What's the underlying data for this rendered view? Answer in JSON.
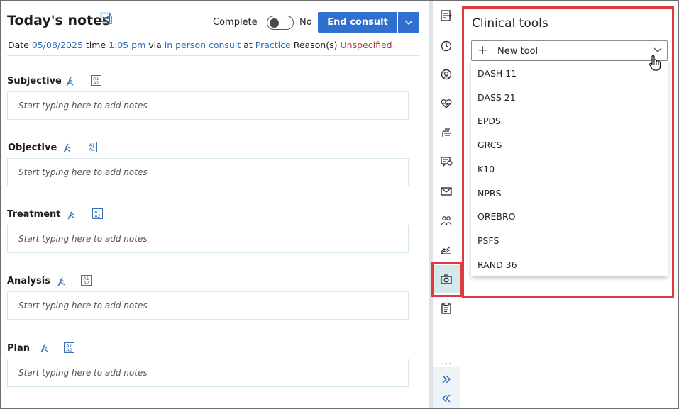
{
  "header": {
    "title": "Today's notes",
    "complete_label": "Complete",
    "toggle_value": "No",
    "end_consult_label": "End consult"
  },
  "meta": {
    "date_label": "Date",
    "date": "05/08/2025",
    "time_label": "time",
    "time": "1:05 pm",
    "via_label": "via",
    "via": "in person consult",
    "at_label": "at",
    "location": "Practice",
    "reason_label": "Reason(s)",
    "reason": "Unspecified"
  },
  "sections": [
    {
      "label": "Subjective",
      "placeholder": "Start typing here to add notes"
    },
    {
      "label": "Objective",
      "placeholder": "Start typing here to add notes"
    },
    {
      "label": "Treatment",
      "placeholder": "Start typing here to add notes"
    },
    {
      "label": "Analysis",
      "placeholder": "Start typing here to add notes"
    },
    {
      "label": "Plan",
      "placeholder": "Start typing here to add notes"
    }
  ],
  "aa_icon": {
    "line1": "A1",
    "line2": "A2"
  },
  "rail": {
    "ellipsis": "...",
    "icons": [
      "notes-icon",
      "clock-icon",
      "user-circle-icon",
      "heart-pulse-icon",
      "allergy-hand-icon",
      "chat-icon",
      "envelope-icon",
      "people-icon",
      "chart-icon",
      "camera-icon",
      "clipboard-icon",
      "expand-icon",
      "collapse-icon"
    ],
    "active": "camera-icon"
  },
  "clinical_tools": {
    "title": "Clinical tools",
    "new_tool_label": "New tool",
    "items": [
      "DASH 11",
      "DASS 21",
      "EPDS",
      "GRCS",
      "K10",
      "NPRS",
      "OREBRO",
      "PSFS",
      "RAND 36"
    ]
  },
  "colors": {
    "primary": "#2f6fcf",
    "link": "#2f6fb8",
    "unspecified": "#b3373b",
    "highlight": "#e03a3e",
    "active_rail": "#d5e9ea"
  }
}
